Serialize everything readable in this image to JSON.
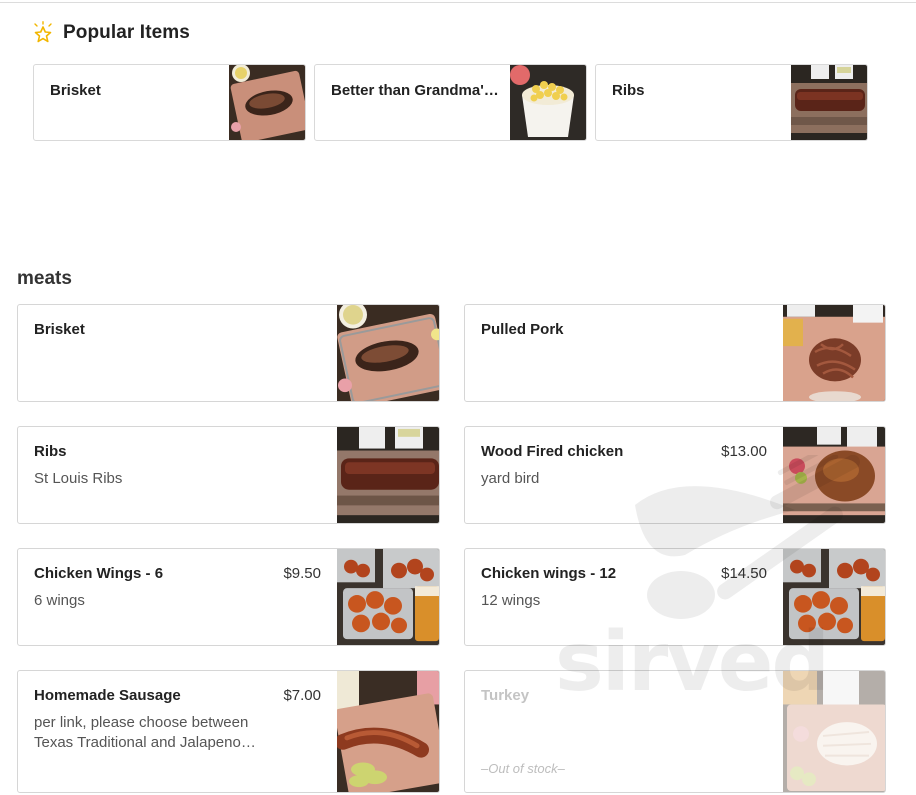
{
  "popular": {
    "title": "Popular Items",
    "items": [
      {
        "name": "Brisket"
      },
      {
        "name": "Better than Grandma's Mac & Cheese"
      },
      {
        "name": "Ribs"
      }
    ]
  },
  "menu": {
    "section_title": "meats",
    "items": [
      {
        "name": "Brisket",
        "price": "",
        "desc": ""
      },
      {
        "name": "Pulled Pork",
        "price": "",
        "desc": ""
      },
      {
        "name": "Ribs",
        "price": "",
        "desc": "St Louis Ribs"
      },
      {
        "name": "Wood Fired chicken",
        "price": "$13.00",
        "desc": "yard bird"
      },
      {
        "name": "Chicken Wings - 6",
        "price": "$9.50",
        "desc": "6 wings"
      },
      {
        "name": "Chicken wings - 12",
        "price": "$14.50",
        "desc": "12 wings"
      },
      {
        "name": "Homemade Sausage",
        "price": "$7.00",
        "desc": "per link, please choose between Texas Traditional and Jalapeno Cheddar"
      },
      {
        "name": "Turkey",
        "price": "",
        "desc": "",
        "stock_label": "–Out of stock–"
      }
    ]
  },
  "watermark": {
    "text": "sirved"
  },
  "icons": {
    "popular": "star-icon",
    "watermark": "fork-spoon-icon"
  }
}
